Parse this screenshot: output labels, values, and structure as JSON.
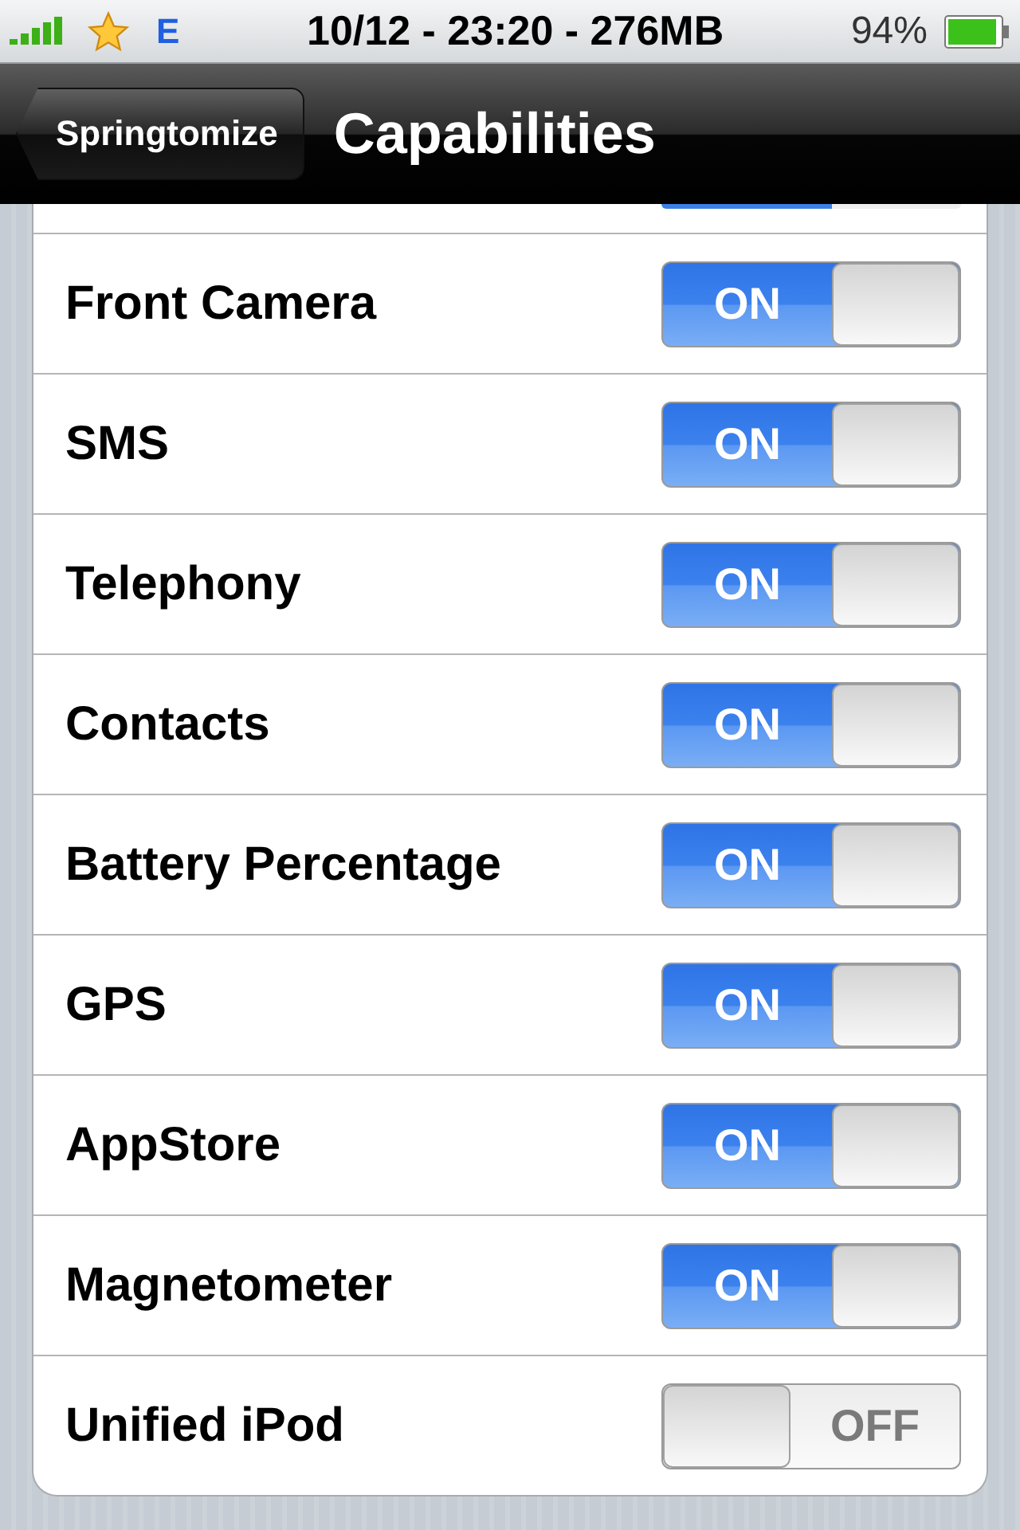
{
  "status_bar": {
    "carrier_type": "E",
    "title": "10/12 - 23:20 - 276MB",
    "battery": "94%"
  },
  "nav_bar": {
    "back": "Springtomize",
    "title": "Capabilities"
  },
  "partial_row": {
    "on": true
  },
  "rows": [
    {
      "label": "Front Camera",
      "on": true,
      "switch_text": "ON"
    },
    {
      "label": "SMS",
      "on": true,
      "switch_text": "ON"
    },
    {
      "label": "Telephony",
      "on": true,
      "switch_text": "ON"
    },
    {
      "label": "Contacts",
      "on": true,
      "switch_text": "ON"
    },
    {
      "label": "Battery Percentage",
      "on": true,
      "switch_text": "ON"
    },
    {
      "label": "GPS",
      "on": true,
      "switch_text": "ON"
    },
    {
      "label": "AppStore",
      "on": true,
      "switch_text": "ON"
    },
    {
      "label": "Magnetometer",
      "on": true,
      "switch_text": "ON"
    },
    {
      "label": "Unified iPod",
      "on": false,
      "switch_text": "OFF"
    }
  ]
}
